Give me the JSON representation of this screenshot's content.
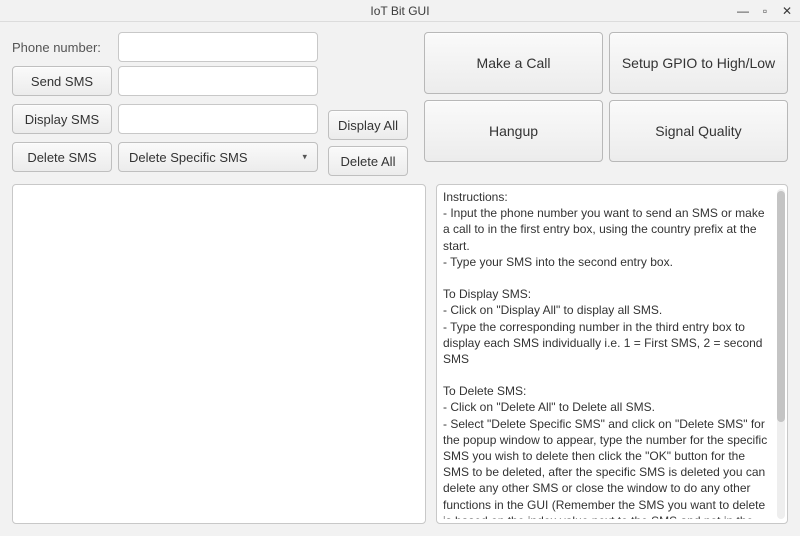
{
  "window": {
    "title": "IoT Bit GUI"
  },
  "left": {
    "phone_label": "Phone number:",
    "send_sms": "Send SMS",
    "display_sms": "Display SMS",
    "delete_sms": "Delete SMS",
    "input_phone": "",
    "input_sms": "",
    "input_extra": "",
    "combo_selected": "Delete Specific SMS"
  },
  "mid": {
    "display_all": "Display All",
    "delete_all": "Delete All"
  },
  "right": {
    "make_call": "Make a Call",
    "setup_gpio": "Setup GPIO to High/Low",
    "hangup": "Hangup",
    "signal_quality": "Signal Quality"
  },
  "instructions": "Instructions:\n- Input the phone number you want to send an SMS or make a call to in the first entry box, using the country prefix at the start.\n- Type your SMS into the second entry box.\n\nTo Display SMS:\n- Click on \"Display All\" to display all SMS.\n- Type the corresponding number in the third entry box to display each SMS individually i.e. 1 = First SMS, 2 = second SMS\n\nTo Delete SMS:\n- Click on \"Delete All\" to Delete all SMS.\n- Select \"Delete Specific SMS\" and click on \"Delete SMS\" for the popup window to appear, type the number for the specific SMS you wish to delete then click the \"OK\" button for the SMS to be deleted, after the specific SMS is deleted you can delete any other SMS or close the window to do any other functions in the GUI (Remember the SMS you want to delete is based on the index value next to the SMS and not in the order you see them appear on the Display Window).\n- Select \"Delete Read\" to delete all \"recived read\" SMS and click on delete SMS.\n- Select \"Delete Read & Sent\" to delete all \"recived read\" and \"stored sent\" and click on delete SMS.\n- Select \"Delete Read, Sent & Unsent\" to delete all \"recived read\", \"stored Sent\" and   \"stored unsent\" and click on delete SMS."
}
